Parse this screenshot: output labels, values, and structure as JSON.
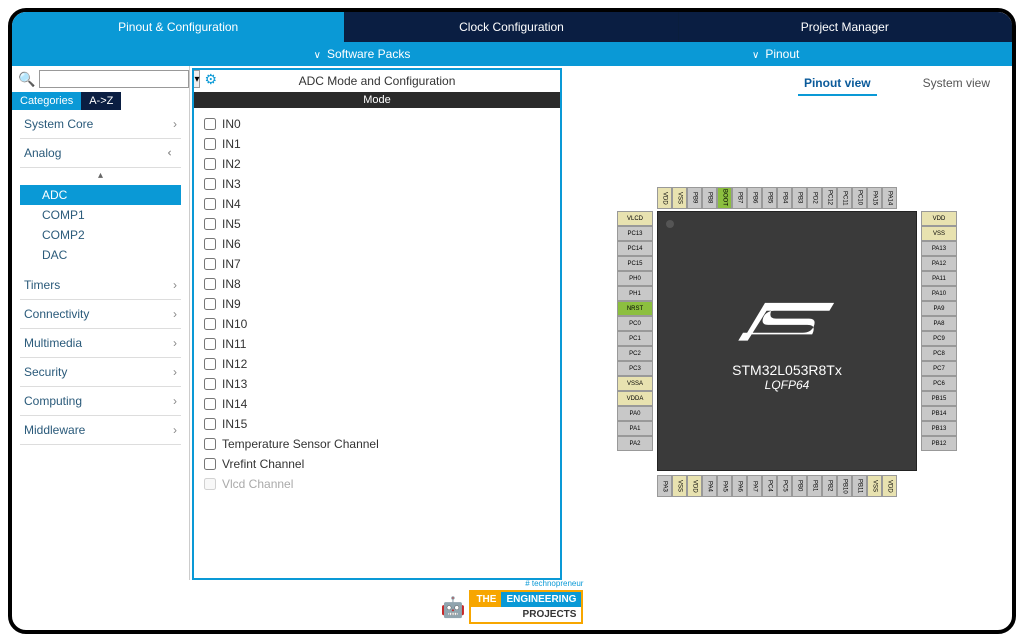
{
  "tabs": {
    "pinout": "Pinout & Configuration",
    "clock": "Clock Configuration",
    "project": "Project Manager"
  },
  "subbar": {
    "software_packs": "Software Packs",
    "pinout": "Pinout"
  },
  "search": {
    "placeholder": ""
  },
  "cat_tabs": {
    "categories": "Categories",
    "az": "A->Z"
  },
  "categories": [
    {
      "label": "System Core",
      "open": false
    },
    {
      "label": "Analog",
      "open": true,
      "children": [
        "ADC",
        "COMP1",
        "COMP2",
        "DAC"
      ],
      "selected": "ADC"
    },
    {
      "label": "Timers",
      "open": false
    },
    {
      "label": "Connectivity",
      "open": false
    },
    {
      "label": "Multimedia",
      "open": false
    },
    {
      "label": "Security",
      "open": false
    },
    {
      "label": "Computing",
      "open": false
    },
    {
      "label": "Middleware",
      "open": false
    }
  ],
  "center": {
    "title": "ADC Mode and Configuration",
    "mode": "Mode",
    "checks": [
      "IN0",
      "IN1",
      "IN2",
      "IN3",
      "IN4",
      "IN5",
      "IN6",
      "IN7",
      "IN8",
      "IN9",
      "IN10",
      "IN11",
      "IN12",
      "IN13",
      "IN14",
      "IN15",
      "Temperature Sensor Channel",
      "Vrefint Channel"
    ],
    "disabled_check": "Vlcd Channel"
  },
  "view_tabs": {
    "pinout": "Pinout view",
    "system": "System view"
  },
  "chip": {
    "name": "STM32L053R8Tx",
    "package": "LQFP64"
  },
  "pins": {
    "top": [
      "VDD",
      "VSS",
      "PB9",
      "PB8",
      "BOOT",
      "PB7",
      "PB6",
      "PB5",
      "PB4",
      "PB3",
      "PD2",
      "PC12",
      "PC11",
      "PC10",
      "PA15",
      "PA14"
    ],
    "left": [
      "VLCD",
      "PC13",
      "PC14",
      "PC15",
      "PH0",
      "PH1",
      "NRST",
      "PC0",
      "PC1",
      "PC2",
      "PC3",
      "VSSA",
      "VDDA",
      "PA0",
      "PA1",
      "PA2"
    ],
    "right": [
      "VDD",
      "VSS",
      "PA13",
      "PA12",
      "PA11",
      "PA10",
      "PA9",
      "PA8",
      "PC9",
      "PC8",
      "PC7",
      "PC6",
      "PB15",
      "PB14",
      "PB13",
      "PB12"
    ],
    "bottom": [
      "PA3",
      "VSS",
      "VDD",
      "PA4",
      "PA5",
      "PA6",
      "PA7",
      "PC4",
      "PC5",
      "PB0",
      "PB1",
      "PB2",
      "PB10",
      "PB11",
      "VSS",
      "VDD"
    ]
  },
  "footer": {
    "hash": "# technopreneur",
    "the": "THE",
    "eng": "ENGINEERING",
    "proj": "PROJECTS"
  }
}
